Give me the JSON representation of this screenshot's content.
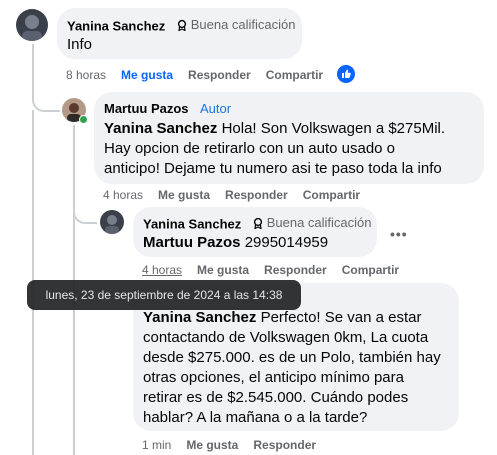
{
  "comments": [
    {
      "author": "Yanina Sanchez",
      "badge": "Buena calificación",
      "text": "Info",
      "time": "8 horas",
      "like": "Me gusta",
      "reply": "Responder",
      "share": "Compartir"
    },
    {
      "author": "Martuu Pazos",
      "role": "Autor",
      "mention": "Yanina Sanchez",
      "text_lines": [
        "Hola! Son Volkswagen a $275Mil.",
        "Hay opcion de retirarlo con un auto usado o",
        "anticipo! Dejame tu numero asi te paso toda la info"
      ],
      "time": "4 horas",
      "like": "Me gusta",
      "reply": "Responder",
      "share": "Compartir"
    },
    {
      "author": "Yanina Sanchez",
      "badge": "Buena calificación",
      "mention": "Martuu Pazos",
      "text": "2995014959",
      "time": "4 horas",
      "like": "Me gusta",
      "reply": "Responder",
      "share": "Compartir",
      "more": "•••"
    },
    {
      "mention": "Yanina Sanchez",
      "text_lines": [
        "Perfecto! Se van a estar",
        "contactando de Volkswagen 0km, La cuota",
        "desde $275.000. es de un Polo, también hay",
        "otras opciones, el anticipo mínimo para",
        "retirar es de $2.545.000. Cuándo podes",
        "hablar? A la mañana o a la tarde?"
      ],
      "time": "1 min",
      "like": "Me gusta",
      "reply": "Responder"
    }
  ],
  "tooltip": "lunes, 23 de septiembre de 2024 a las 14:38",
  "colors": {
    "accent": "#0866ff",
    "bubble": "#f0f2f5",
    "muted": "#65676b"
  }
}
